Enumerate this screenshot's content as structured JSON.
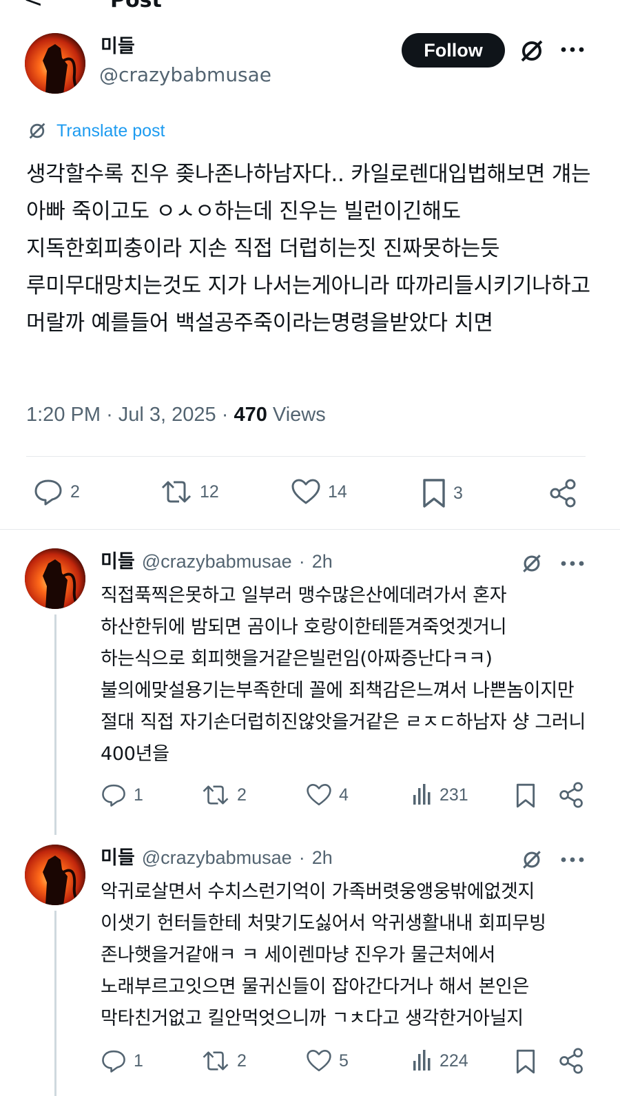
{
  "header": {
    "back_glyph": "<",
    "title": "Post"
  },
  "post": {
    "display_name": "미들",
    "handle": "@crazybabmusae",
    "follow_label": "Follow",
    "translate_label": "Translate post",
    "text": "생각할수록 진우 좆나존나하남자다.. 카일로렌대입법해보면 걔는 아빠 죽이고도 ㅇㅅㅇ하는데 진우는 빌런이긴해도 지독한회피충이라 지손 직접 더럽히는짓 진짜못하는듯 루미무대망치는것도 지가 나서는게아니라 따까리들시키기나하고 머랄까 예를들어 백설공주죽이라는명령을받았다 치면",
    "time": "1:20 PM",
    "date": "Jul 3, 2025",
    "views_count": "470",
    "views_label": "Views",
    "actions": {
      "replies": "2",
      "reposts": "12",
      "likes": "14",
      "bookmarks": "3"
    }
  },
  "replies": [
    {
      "display_name": "미들",
      "handle": "@crazybabmusae",
      "age": "2h",
      "text": "직접푹찍은못하고 일부러 맹수많은산에데려가서 혼자 하산한뒤에 밤되면 곰이나 호랑이한테뜯겨죽엇겟거니 하는식으로 회피햇을거같은빌런임(아짜증난다ㅋㅋ) 불의에맞설용기는부족한데 꼴에 죄책감은느껴서 나쁜놈이지만 절대 직접 자기손더럽히진않앗을거같은 ㄹㅈㄷ하남자 샹 그러니 400년을",
      "actions": {
        "replies": "1",
        "reposts": "2",
        "likes": "4",
        "views": "231"
      }
    },
    {
      "display_name": "미들",
      "handle": "@crazybabmusae",
      "age": "2h",
      "text": "악귀로살면서 수치스런기억이 가족버렷웅앵웅밖에없겟지 이샛기 헌터들한테 처맞기도싫어서 악귀생활내내 회피무빙 존나햇을거같애ㅋ ㅋ 세이렌마냥 진우가 물근처에서 노래부르고잇으면 물귀신들이 잡아간다거나 해서 본인은 막타친거없고 킬안먹엇으니까 ㄱㅊ다고 생각한거아닐지",
      "actions": {
        "replies": "1",
        "reposts": "2",
        "likes": "5",
        "views": "224"
      }
    }
  ],
  "icons": {
    "accent": "#1d9bf0",
    "muted": "#536471",
    "dark": "#0f1419"
  }
}
